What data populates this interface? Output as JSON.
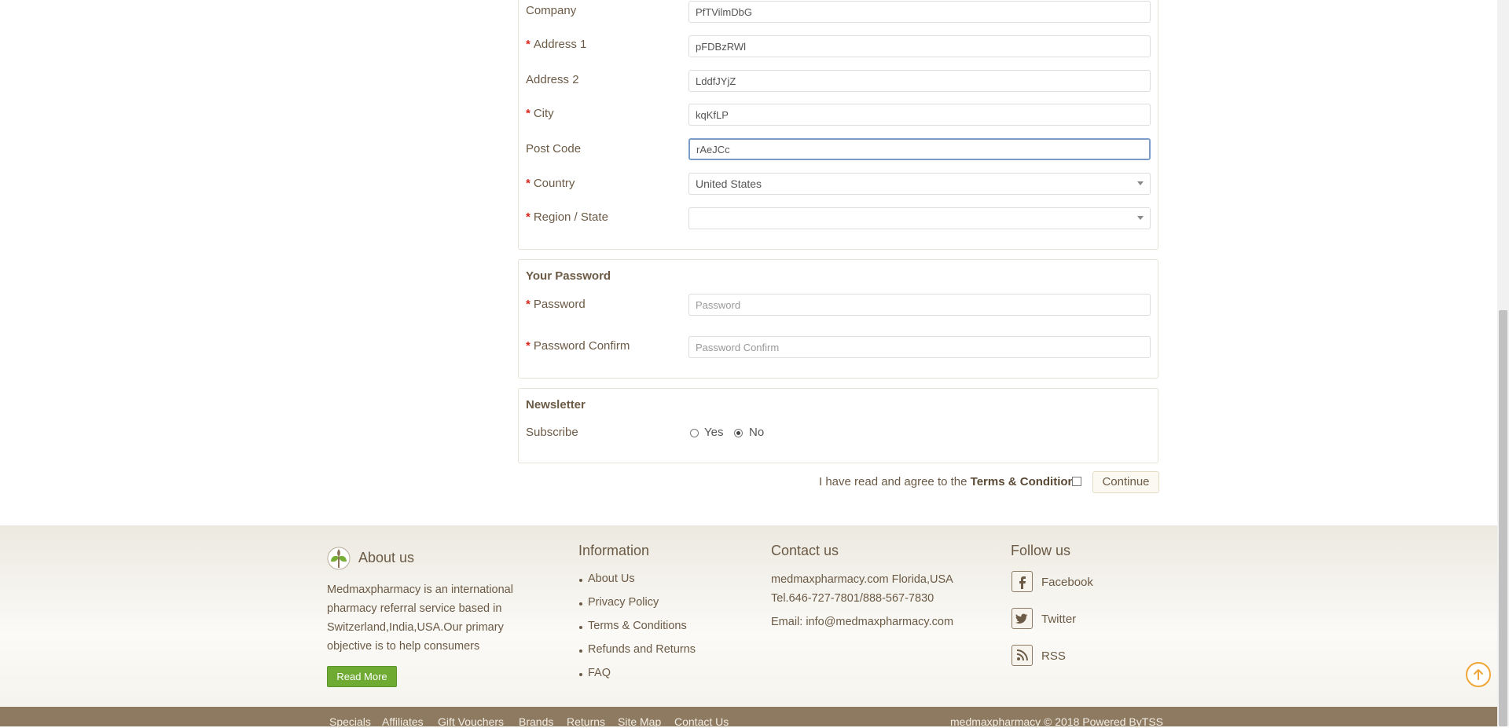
{
  "address_form": {
    "company": {
      "label": "Company",
      "value": "PfTVilmDbG"
    },
    "address1": {
      "label": "Address 1",
      "value": "pFDBzRWl"
    },
    "address2": {
      "label": "Address 2",
      "value": "LddfJYjZ"
    },
    "city": {
      "label": "City",
      "value": "kqKfLP"
    },
    "postcode": {
      "label": "Post Code",
      "value": "rAeJCc"
    },
    "country": {
      "label": "Country",
      "value": "United States"
    },
    "region": {
      "label": "Region / State",
      "value": ""
    }
  },
  "password_section": {
    "legend": "Your Password",
    "password": {
      "label": "Password",
      "placeholder": "Password"
    },
    "confirm": {
      "label": "Password Confirm",
      "placeholder": "Password Confirm"
    }
  },
  "newsletter": {
    "legend": "Newsletter",
    "subscribe_label": "Subscribe",
    "yes_label": "Yes",
    "no_label": "No",
    "selected": "No"
  },
  "agreement": {
    "text": "I have read and agree to the",
    "link": "Terms & Conditions",
    "checked": false,
    "continue_label": "Continue"
  },
  "footer": {
    "about": {
      "title": "About us",
      "text": "Medmaxpharmacy is an international pharmacy referral service based in Switzerland,India,USA.Our primary objective is to help consumers",
      "read_more": "Read More"
    },
    "information": {
      "title": "Information",
      "links": [
        "About Us",
        "Privacy Policy",
        "Terms & Conditions",
        "Refunds and Returns",
        "FAQ"
      ]
    },
    "contact": {
      "title": "Contact us",
      "line1": "medmaxpharmacy.com Florida,USA",
      "line2": "Tel.646-727-7801/888-567-7830",
      "email": "Email: info@medmaxpharmacy.com"
    },
    "follow": {
      "title": "Follow us",
      "items": [
        "Facebook",
        "Twitter",
        "RSS"
      ]
    },
    "bottom_links": [
      "Specials",
      "Affiliates",
      "Gift Vouchers",
      "Brands",
      "Returns",
      "Site Map",
      "Contact Us"
    ],
    "copyright": "medmaxpharmacy © 2018 Powered ByTSS"
  },
  "colors": {
    "required": "#d9261c",
    "text_brown": "#6b5a45",
    "read_more_green": "#6fab33",
    "footer_bar": "#8d7a60",
    "scroll_top_orange": "#f0a637"
  }
}
